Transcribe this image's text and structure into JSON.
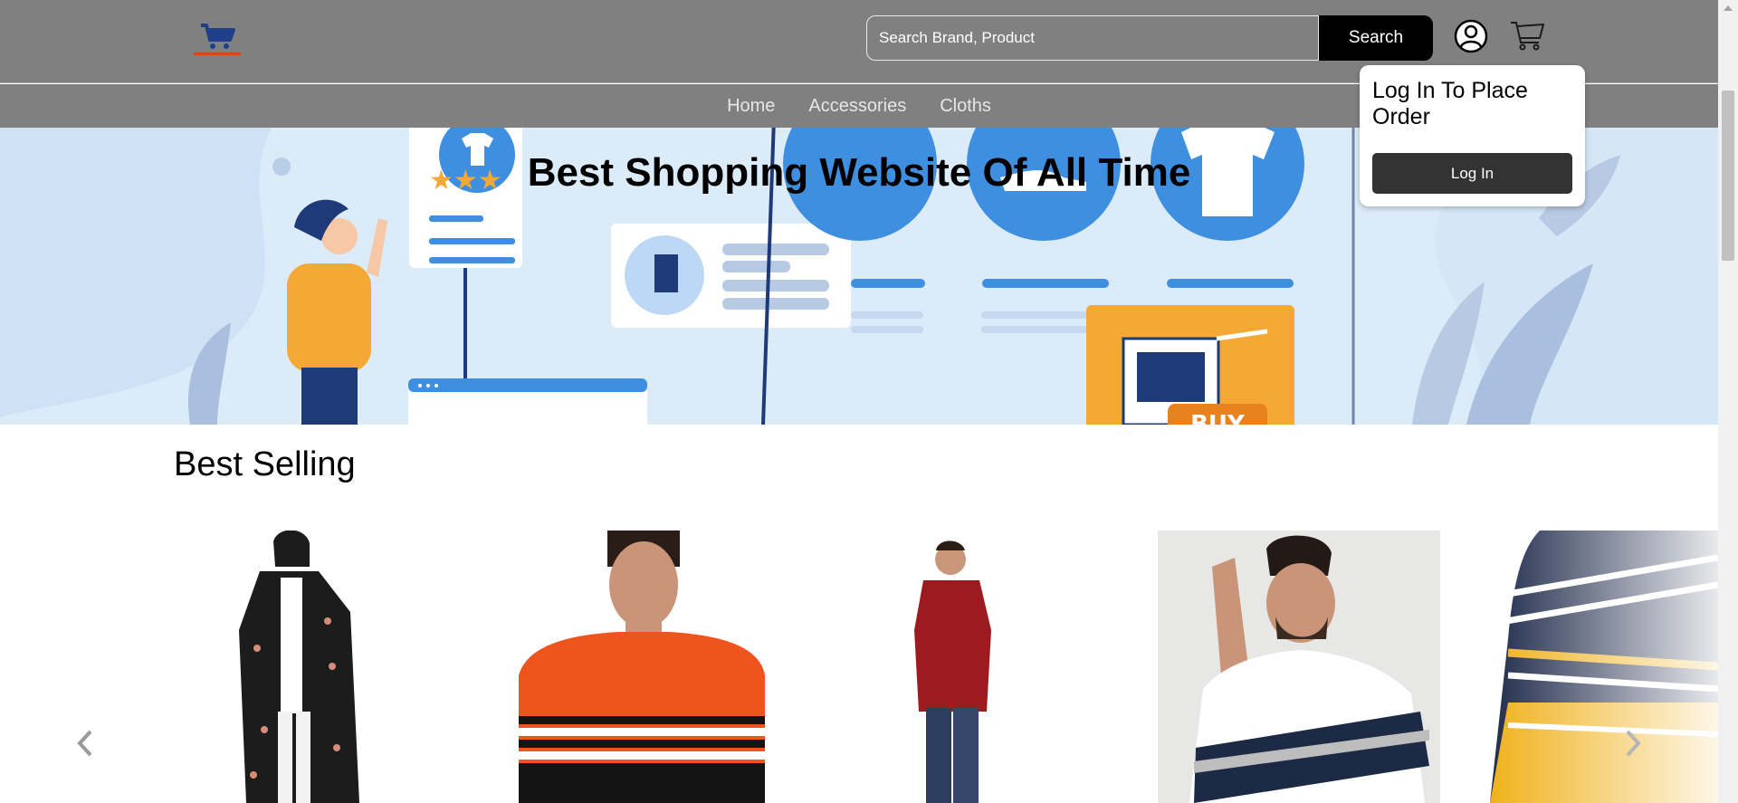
{
  "header": {
    "search_placeholder": "Search Brand, Product",
    "search_button_label": "Search"
  },
  "nav": {
    "items": [
      {
        "label": "Home"
      },
      {
        "label": "Accessories"
      },
      {
        "label": "Cloths"
      }
    ]
  },
  "hero": {
    "title": "Best Shopping Website Of All Time",
    "badge_text": "BUY"
  },
  "login_popup": {
    "message": "Log In To Place Order",
    "button_label": "Log In"
  },
  "best_selling": {
    "title": "Best Selling",
    "products": [
      {
        "name": "product-floral-long-shrug"
      },
      {
        "name": "product-orange-striped-sweater"
      },
      {
        "name": "product-maroon-sweater"
      },
      {
        "name": "product-colorblock-tshirt"
      },
      {
        "name": "product-yellow-striped-sweater"
      }
    ]
  },
  "icons": {
    "logo": "cart-logo-icon",
    "user": "user-circle-icon",
    "cart": "cart-icon",
    "prev": "chevron-left-icon",
    "next": "chevron-right-icon"
  },
  "colors": {
    "header_bg": "#808080",
    "search_button_bg": "#000000",
    "login_button_bg": "#333333",
    "hero_bg": "#dcebf8",
    "hero_accent": "#3f8fe0",
    "orange_accent": "#f5a935"
  }
}
